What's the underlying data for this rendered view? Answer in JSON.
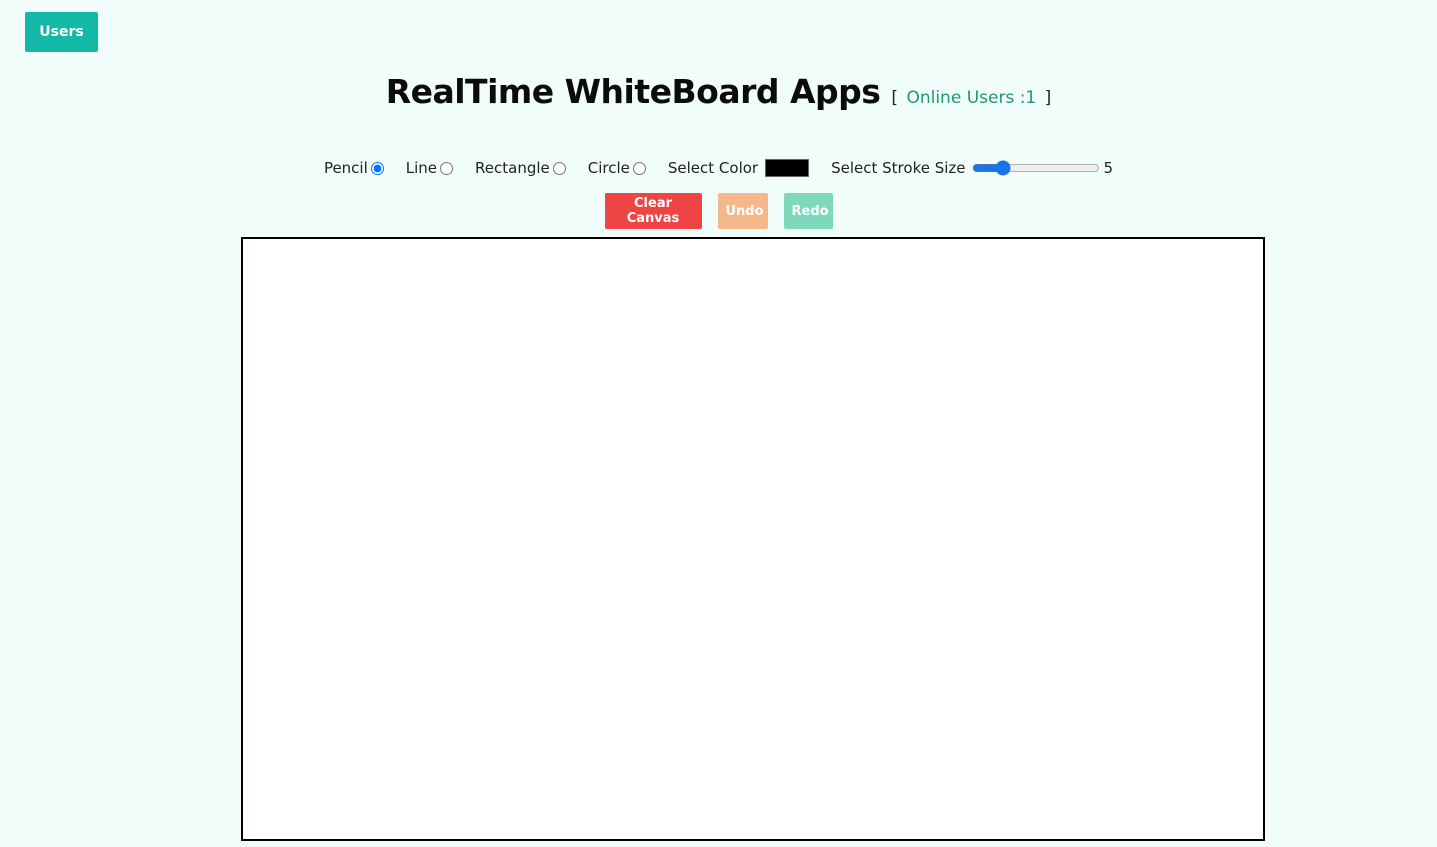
{
  "top_bar": {
    "users_label": "Users"
  },
  "header": {
    "title": "RealTime WhiteBoard Apps",
    "online_open": "[",
    "online_text": "Online Users :1",
    "online_close": "]"
  },
  "toolbar": {
    "tools": [
      {
        "label": "Pencil",
        "selected": true
      },
      {
        "label": "Line",
        "selected": false
      },
      {
        "label": "Rectangle",
        "selected": false
      },
      {
        "label": "Circle",
        "selected": false
      }
    ],
    "color_label": "Select Color",
    "color_value": "#000000",
    "stroke_label": "Select Stroke Size",
    "stroke_value": "5"
  },
  "actions": {
    "clear_label": "Clear Canvas",
    "undo_label": "Undo",
    "redo_label": "Redo"
  },
  "colors": {
    "background": "#f0fdfa",
    "users_button": "#14b8a6",
    "clear_button": "#ef4444",
    "undo_button": "#f4b88a",
    "redo_button": "#7dd8bc",
    "online_text": "#1f9a6c"
  }
}
